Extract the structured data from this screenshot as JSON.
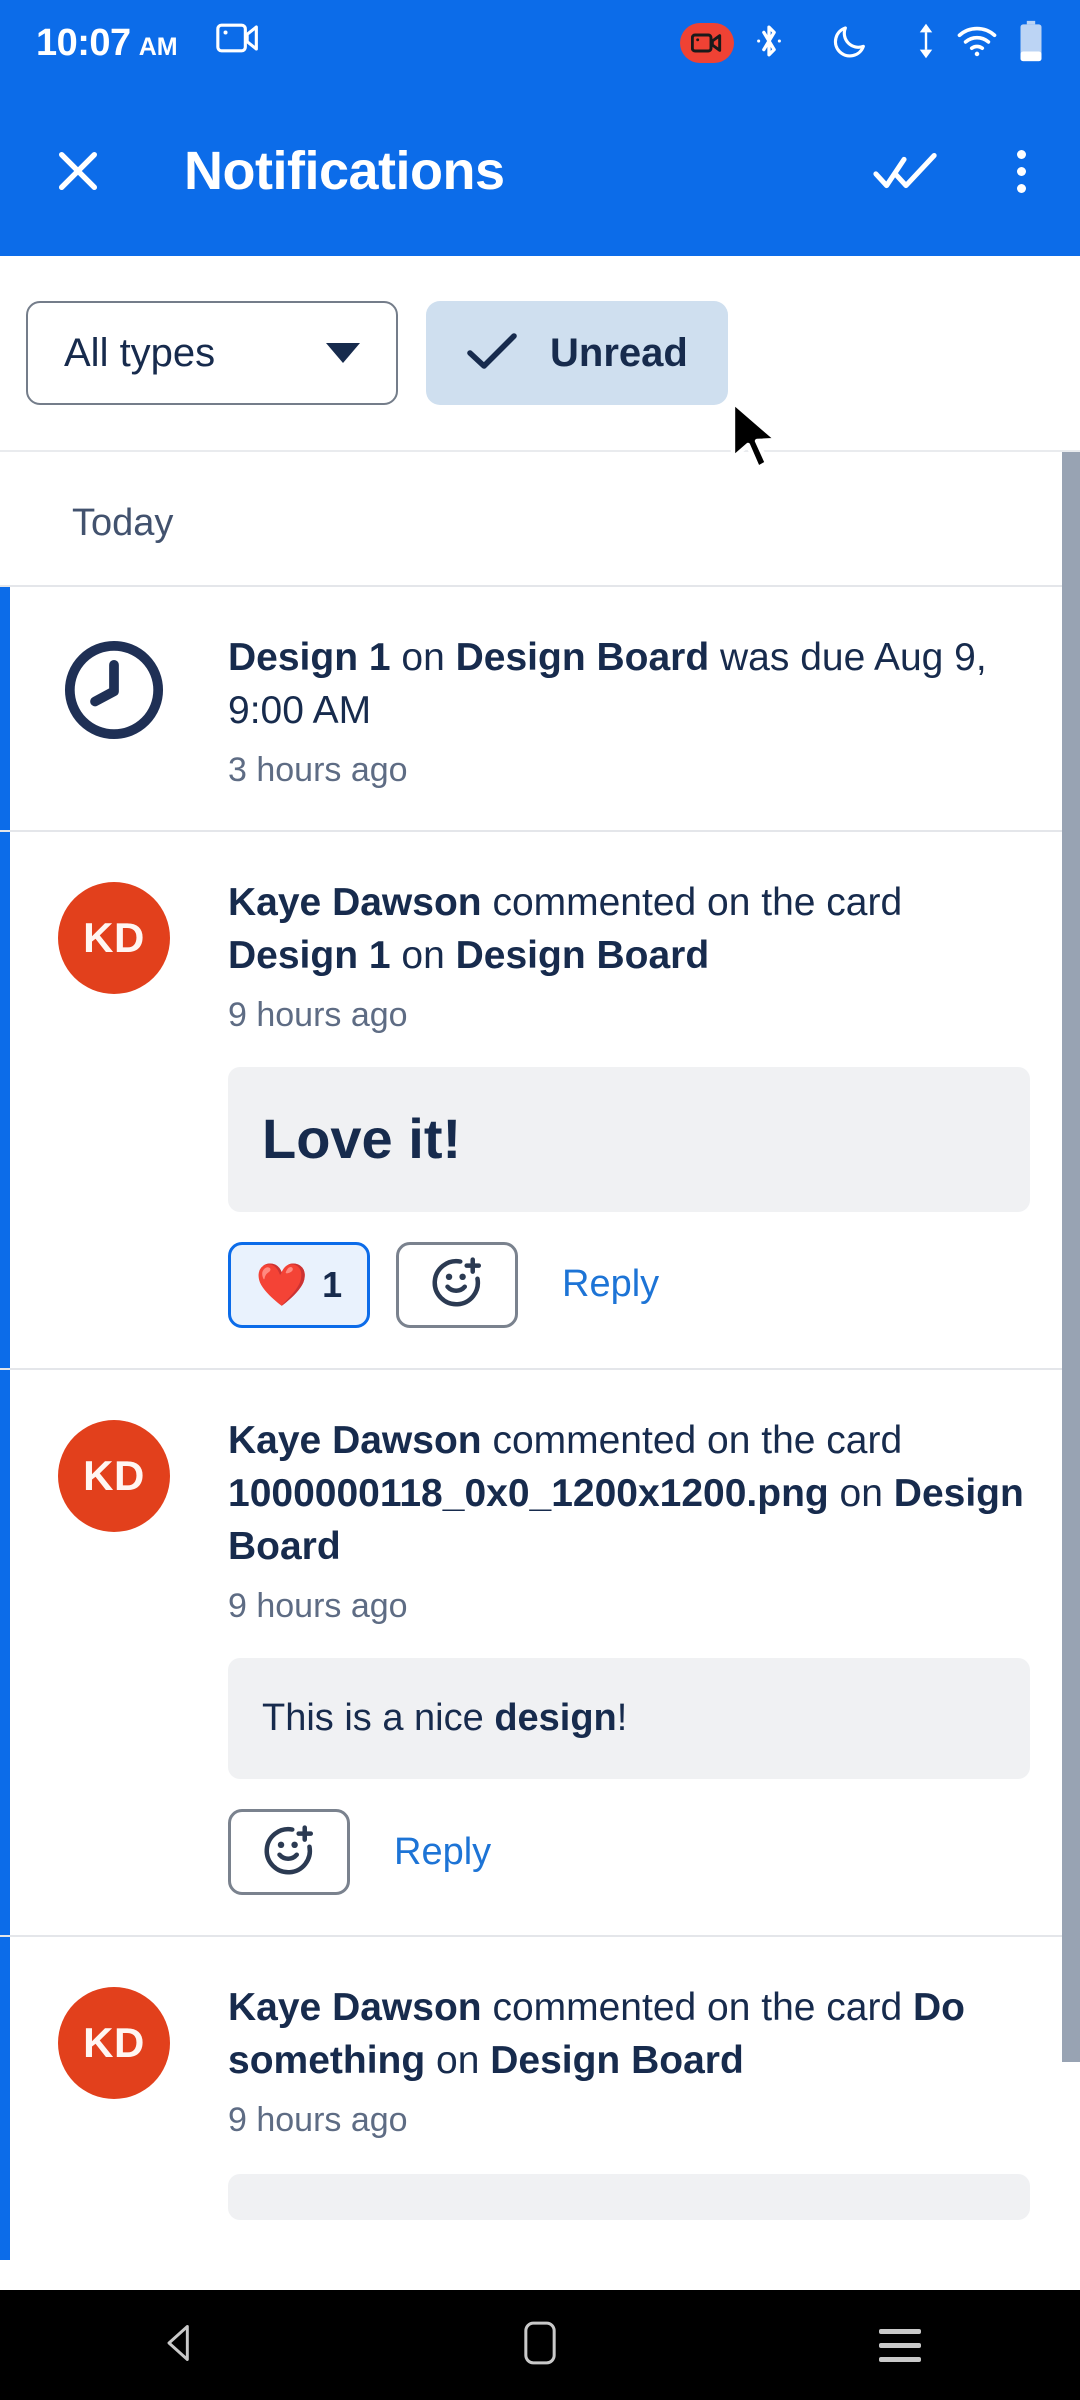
{
  "status_bar": {
    "time": "10:07",
    "ampm": "AM",
    "icons": [
      "video-camera-icon",
      "screen-record-icon",
      "bluetooth-icon",
      "do-not-disturb-moon-icon",
      "data-transfer-icon",
      "wifi-icon",
      "battery-icon"
    ]
  },
  "app_bar": {
    "close_label": "×",
    "title": "Notifications",
    "mark_all_read_label": "mark-all-read",
    "overflow_label": "more-options"
  },
  "filters": {
    "type_filter_label": "All types",
    "unread_chip_label": "Unread",
    "unread_selected": true
  },
  "colors": {
    "brand_blue": "#0c6ce9",
    "unread_indicator": "#0c6ce9",
    "avatar_red": "#e2401c",
    "link_blue": "#1d74d6",
    "text_dark": "#172b4d",
    "text_muted": "#5e6c84",
    "chip_selected_bg": "#cfdfef",
    "bubble_bg": "#f0f1f3"
  },
  "list": {
    "section_label": "Today",
    "notifications": [
      {
        "id": "n1",
        "unread": true,
        "icon": "clock-icon",
        "avatar_initials": null,
        "text_parts": [
          {
            "t": "Design 1",
            "b": true
          },
          {
            "t": " on ",
            "b": false
          },
          {
            "t": "Design Board",
            "b": true
          },
          {
            "t": " was due Aug 9, 9:00 AM",
            "b": false
          }
        ],
        "time": "3 hours ago",
        "comment": null,
        "actions": []
      },
      {
        "id": "n2",
        "unread": true,
        "icon": null,
        "avatar_initials": "KD",
        "text_parts": [
          {
            "t": "Kaye Dawson",
            "b": true
          },
          {
            "t": " commented on the card ",
            "b": false
          },
          {
            "t": "Design 1",
            "b": true
          },
          {
            "t": " on ",
            "b": false
          },
          {
            "t": "Design Board",
            "b": true
          }
        ],
        "time": "9 hours ago",
        "comment": {
          "style": "big",
          "parts": [
            {
              "t": "Love it!",
              "b": true
            }
          ]
        },
        "actions": [
          "reaction",
          "add-reaction",
          "reply"
        ],
        "reaction_emoji": "❤️",
        "reaction_count": "1",
        "reply_label": "Reply"
      },
      {
        "id": "n3",
        "unread": true,
        "icon": null,
        "avatar_initials": "KD",
        "text_parts": [
          {
            "t": "Kaye Dawson",
            "b": true
          },
          {
            "t": " commented on the card ",
            "b": false
          },
          {
            "t": "1000000118_0x0_1200x1200.png",
            "b": true
          },
          {
            "t": " on ",
            "b": false
          },
          {
            "t": "Design Board",
            "b": true
          }
        ],
        "time": "9 hours ago",
        "comment": {
          "style": "normal",
          "parts": [
            {
              "t": "This is a nice ",
              "b": false
            },
            {
              "t": "design",
              "b": true
            },
            {
              "t": "!",
              "b": false
            }
          ]
        },
        "actions": [
          "add-reaction",
          "reply"
        ],
        "reply_label": "Reply"
      },
      {
        "id": "n4",
        "unread": true,
        "icon": null,
        "avatar_initials": "KD",
        "text_parts": [
          {
            "t": "Kaye Dawson",
            "b": true
          },
          {
            "t": " commented on the card ",
            "b": false
          },
          {
            "t": "Do something",
            "b": true
          },
          {
            "t": " on ",
            "b": false
          },
          {
            "t": "Design Board",
            "b": true
          }
        ],
        "time": "9 hours ago",
        "comment": {
          "style": "stub",
          "parts": []
        },
        "actions": []
      }
    ]
  },
  "nav_bar": {
    "back_label": "back",
    "home_label": "home",
    "recents_label": "recents"
  }
}
